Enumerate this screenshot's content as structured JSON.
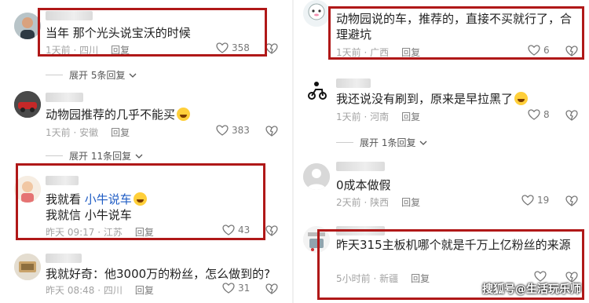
{
  "left_comments": [
    {
      "text": "当年 那个光头说宝沃的时候",
      "time": "1天前 · 四川",
      "reply": "回复",
      "likes": "358"
    },
    {
      "text": "动物园推荐的几乎不能买",
      "time": "1天前 · 安徽",
      "reply": "回复",
      "likes": "383"
    },
    {
      "line1_prefix": "我就看 ",
      "line1_link": "小牛说车",
      "line2": "我就信 小牛说车",
      "time": "昨天 09:17 · 江苏",
      "reply": "回复",
      "likes": "43"
    },
    {
      "text": "我就好奇：他3000万的粉丝，怎么做到的?",
      "time": "昨天 08:48 · 四川",
      "reply": "回复",
      "likes": "31"
    }
  ],
  "left_expand": [
    "展开 5条回复",
    "展开 11条回复"
  ],
  "right_comments": [
    {
      "line1": "动物园说的车，推荐的，直接不买就行了，合",
      "line2": "理避坑",
      "time": "1天前 · 广西",
      "reply": "回复",
      "likes": "6"
    },
    {
      "text": "我还说没有刷到，原来是早拉黑了",
      "time": "1天前 · 河南",
      "reply": "回复",
      "likes": "8"
    },
    {
      "text": "0成本做假",
      "time": "2天前 · 陕西",
      "reply": "回复",
      "likes": "19"
    },
    {
      "text": "昨天315主板机哪个就是千万上亿粉丝的来源",
      "time": "5小时前 · 新疆",
      "reply": "回复",
      "likes": ""
    }
  ],
  "right_expand": [
    "展开 1条回复"
  ],
  "watermark": "搜狐号@生活玩乐师",
  "colors": {
    "highlight": "#b01818",
    "link": "#1f5cc4",
    "meta": "#a3a3a3"
  }
}
